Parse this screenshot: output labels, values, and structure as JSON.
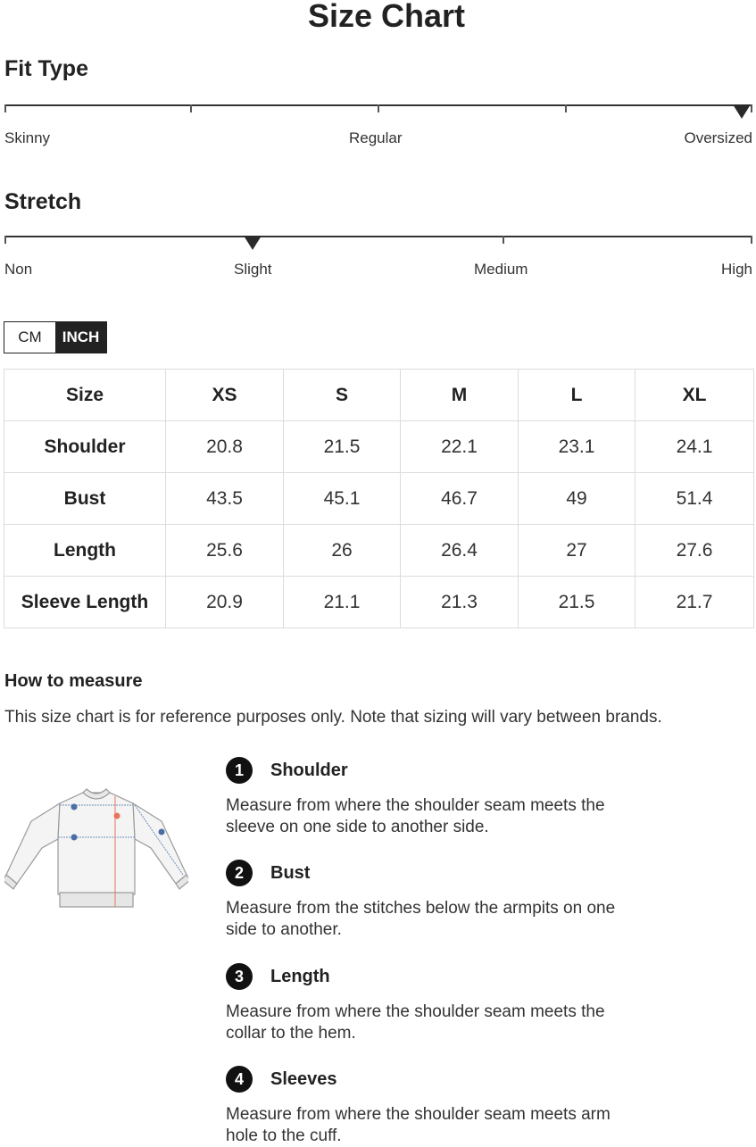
{
  "page_title": "Size Chart",
  "fit_type": {
    "heading": "Fit Type",
    "labels": [
      "Skinny",
      "Regular",
      "Oversized"
    ],
    "selected": "Oversized"
  },
  "stretch": {
    "heading": "Stretch",
    "labels": [
      "Non",
      "Slight",
      "Medium",
      "High"
    ],
    "selected": "Slight"
  },
  "units": {
    "cm": "CM",
    "inch": "INCH",
    "selected": "INCH"
  },
  "table": {
    "header": [
      "Size",
      "XS",
      "S",
      "M",
      "L",
      "XL"
    ],
    "rows": [
      [
        "Shoulder",
        "20.8",
        "21.5",
        "22.1",
        "23.1",
        "24.1"
      ],
      [
        "Bust",
        "43.5",
        "45.1",
        "46.7",
        "49",
        "51.4"
      ],
      [
        "Length",
        "25.6",
        "26",
        "26.4",
        "27",
        "27.6"
      ],
      [
        "Sleeve Length",
        "20.9",
        "21.1",
        "21.3",
        "21.5",
        "21.7"
      ]
    ]
  },
  "how_to_measure": {
    "title": "How to measure",
    "note": "This size chart is for reference purposes only. Note that sizing will vary between brands.",
    "steps": [
      {
        "number": "1",
        "name": "Shoulder",
        "desc": "Measure from where the shoulder seam meets the sleeve on one side to another side."
      },
      {
        "number": "2",
        "name": "Bust",
        "desc": "Measure from the stitches below the armpits on one side to another."
      },
      {
        "number": "3",
        "name": "Length",
        "desc": "Measure from where the shoulder seam meets the collar to the hem."
      },
      {
        "number": "4",
        "name": "Sleeves",
        "desc": "Measure from where the shoulder seam meets arm hole to the cuff."
      }
    ]
  },
  "colors": {
    "marker": "#2a2a2a",
    "accent_measure": "#e8745a",
    "measure_dot": "#4a6fa5"
  }
}
